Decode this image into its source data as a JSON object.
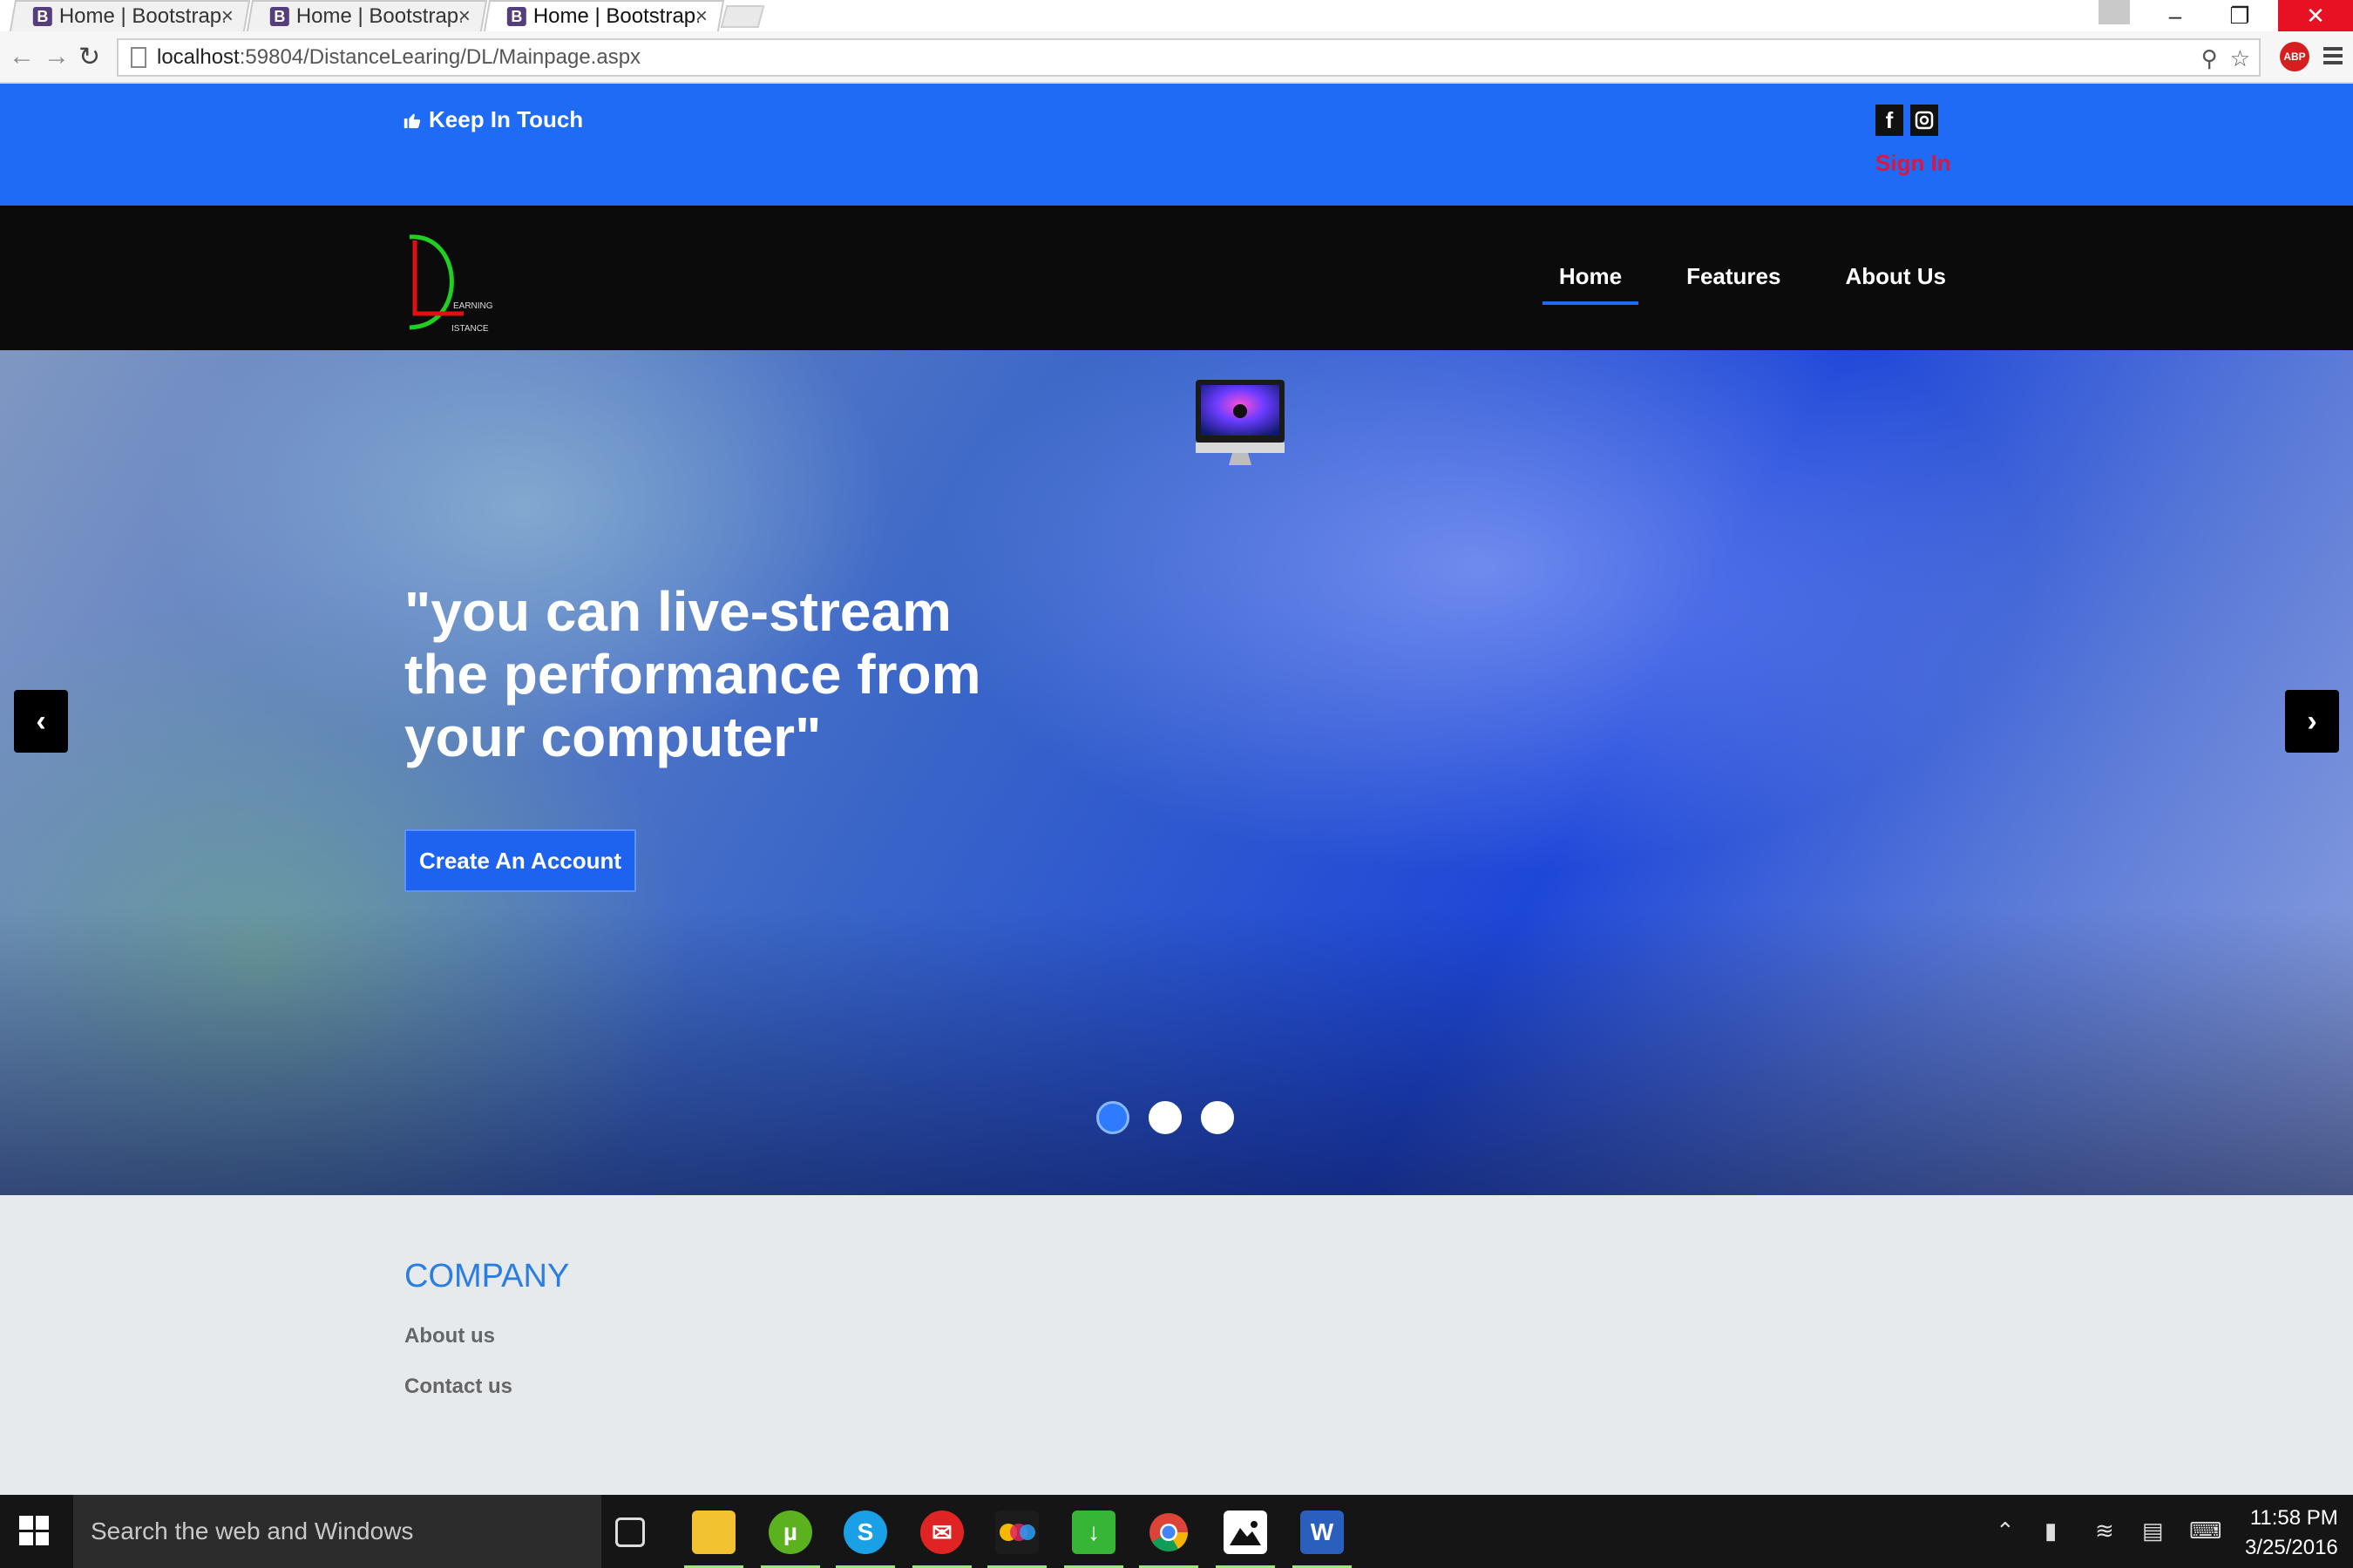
{
  "browser": {
    "tabs": [
      {
        "label": "Home | Bootstrap.n",
        "favicon": "B",
        "active": false
      },
      {
        "label": "Home | Bootstrap.n",
        "favicon": "B",
        "active": false
      },
      {
        "label": "Home | Bootstrap.n",
        "favicon": "B",
        "active": true
      }
    ],
    "close_glyph": "×",
    "url_host": "localhost",
    "url_rest": ":59804/DistanceLearing/DL/Mainpage.aspx"
  },
  "topbar": {
    "keep_in_touch": "Keep In Touch",
    "facebook_glyph": "f",
    "sign_in": "Sign In",
    "background_color": "#1e6bf5",
    "sign_in_color": "#e0143c"
  },
  "logo": {
    "letter": "D",
    "line1": "EARNING",
    "line2": "ISTANCE"
  },
  "nav": {
    "items": [
      {
        "label": "Home",
        "active": true
      },
      {
        "label": "Features",
        "active": false
      },
      {
        "label": "About Us",
        "active": false
      }
    ]
  },
  "hero": {
    "headline": "\"you can live-stream the performance from your computer\"",
    "cta_label": "Create An Account",
    "prev_glyph": "‹",
    "next_glyph": "›",
    "slide_count": 3,
    "active_slide": 1
  },
  "footer": {
    "section_title": "COMPANY",
    "links": [
      "About us",
      "Contact us"
    ],
    "title_color": "#2a7de1"
  },
  "taskbar": {
    "search_placeholder": "Search the web and Windows",
    "time": "11:58 PM",
    "date": "3/25/2016",
    "apps": [
      "task-view-icon",
      "file-explorer-icon",
      "utorrent-icon",
      "skype-icon",
      "mail-icon",
      "photo-app-icon",
      "download-app-icon",
      "chrome-icon",
      "photos-icon",
      "word-icon"
    ]
  }
}
